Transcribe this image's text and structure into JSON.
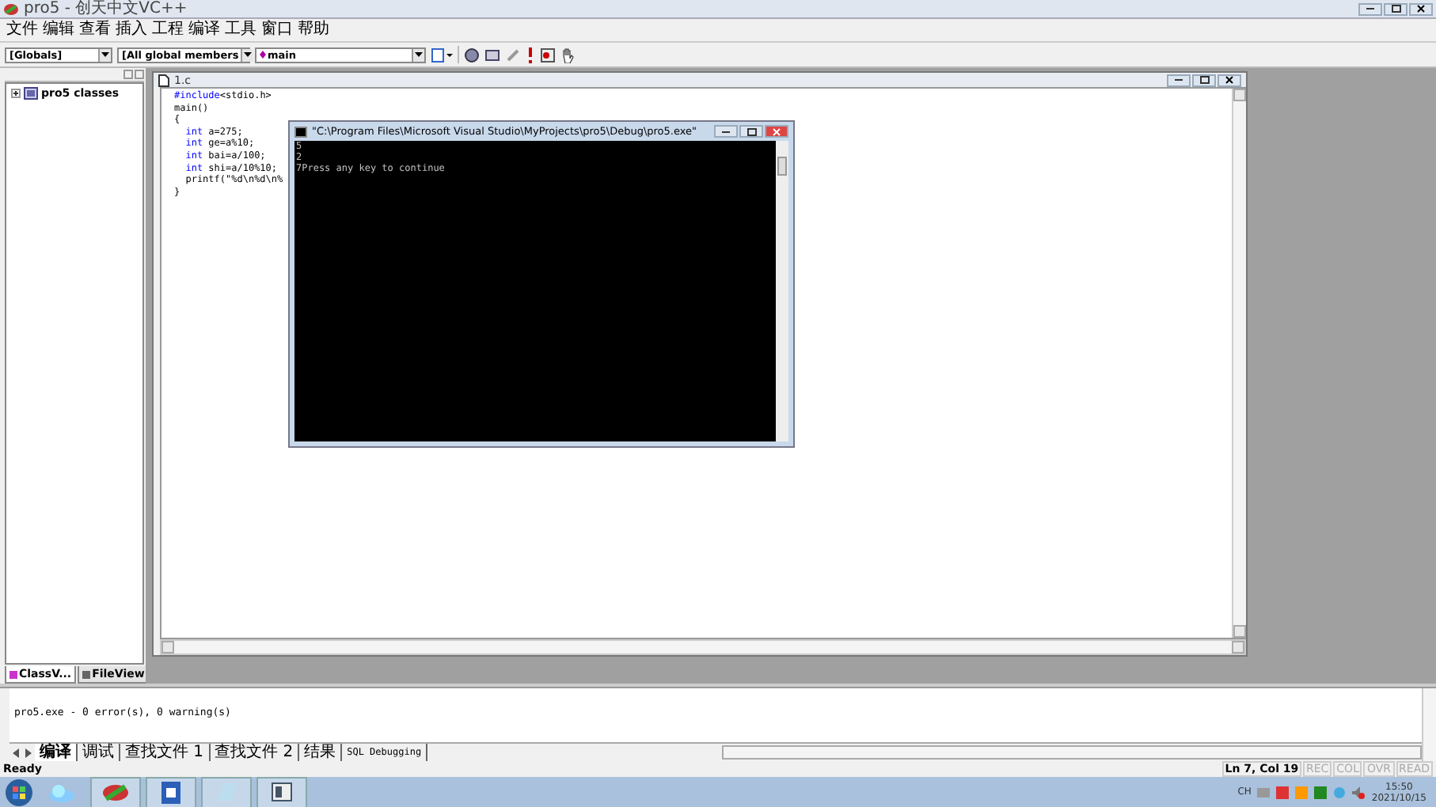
{
  "window": {
    "title": "pro5 - 创天中文VC++"
  },
  "menu": [
    "文件",
    "编辑",
    "查看",
    "插入",
    "工程",
    "编译",
    "工具",
    "窗口",
    "帮助"
  ],
  "toolbar": {
    "scope": "[Globals]",
    "members": "[All global members",
    "function": "main"
  },
  "workspace": {
    "tree": [
      {
        "label": "pro5 classes",
        "expanded": false
      }
    ],
    "tabs": [
      {
        "label": "ClassV...",
        "selected": true
      },
      {
        "label": "FileView",
        "selected": false
      }
    ]
  },
  "editor": {
    "title": "1.c",
    "lines": [
      [
        {
          "kind": "keyword",
          "text": "#include"
        },
        {
          "kind": "plain",
          "text": "<stdio.h>"
        }
      ],
      [
        {
          "kind": "plain",
          "text": "main()"
        }
      ],
      [
        {
          "kind": "plain",
          "text": "{"
        }
      ],
      [
        {
          "kind": "keyword",
          "text": "  int"
        },
        {
          "kind": "plain",
          "text": " a=275;"
        }
      ],
      [
        {
          "kind": "keyword",
          "text": "  int"
        },
        {
          "kind": "plain",
          "text": " ge=a%10;"
        }
      ],
      [
        {
          "kind": "keyword",
          "text": "  int"
        },
        {
          "kind": "plain",
          "text": " bai=a/100;"
        }
      ],
      [
        {
          "kind": "keyword",
          "text": "  int"
        },
        {
          "kind": "plain",
          "text": " shi=a/10%10;"
        }
      ],
      [
        {
          "kind": "plain",
          "text": "  printf(\"%d\\n%d\\n%"
        }
      ],
      [
        {
          "kind": "plain",
          "text": "}"
        }
      ]
    ]
  },
  "console": {
    "title": "\"C:\\Program Files\\Microsoft Visual Studio\\MyProjects\\pro5\\Debug\\pro5.exe\"",
    "lines": [
      "5",
      "2",
      "7Press any key to continue"
    ]
  },
  "output": {
    "text": "pro5.exe - 0 error(s), 0 warning(s)",
    "tabs": [
      {
        "label": "编译",
        "selected": true
      },
      {
        "label": "调试",
        "selected": false
      },
      {
        "label": "查找文件 1",
        "selected": false
      },
      {
        "label": "查找文件 2",
        "selected": false
      },
      {
        "label": "结果",
        "selected": false
      },
      {
        "label": "SQL Debugging",
        "selected": false
      }
    ]
  },
  "status_bar": {
    "message": "Ready",
    "position": "Ln 7, Col 19",
    "indicators": [
      {
        "label": "REC",
        "disabled": true
      },
      {
        "label": "COL",
        "disabled": true
      },
      {
        "label": "OVR",
        "disabled": true
      },
      {
        "label": "READ",
        "disabled": true
      }
    ]
  },
  "taskbar": {
    "language": "CH",
    "time": "15:50",
    "date": "2021/10/15"
  }
}
